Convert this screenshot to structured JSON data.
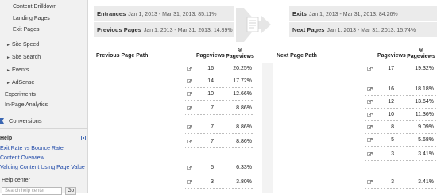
{
  "sidebar": {
    "items": [
      {
        "label": "Content Drilldown"
      },
      {
        "label": "Landing Pages"
      },
      {
        "label": "Exit Pages"
      },
      {
        "label": "Site Speed"
      },
      {
        "label": "Site Search"
      },
      {
        "label": "Events"
      },
      {
        "label": "AdSense"
      },
      {
        "label": "Experiments"
      },
      {
        "label": "In-Page Analytics"
      }
    ],
    "conversions_label": "Conversions",
    "help": {
      "heading": "Help",
      "links": [
        "Exit Rate vs Bounce Rate",
        "Content Overview",
        "Valuing Content Using Page Value"
      ],
      "help_center": "Help center",
      "search_placeholder": "Search help center",
      "go_label": "Go"
    }
  },
  "flow": {
    "entrances": {
      "label": "Entrances",
      "range": "Jan 1, 2013 - Mar 31, 2013: 85.11%"
    },
    "previous_pages": {
      "label": "Previous Pages",
      "range": "Jan 1, 2013 - Mar 31, 2013: 14.89%"
    },
    "exits": {
      "label": "Exits",
      "range": "Jan 1, 2013 - Mar 31, 2013: 84.26%"
    },
    "next_pages": {
      "label": "Next Pages",
      "range": "Jan 1, 2013 - Mar 31, 2013: 15.74%"
    }
  },
  "previous_table": {
    "headers": {
      "path": "Previous Page Path",
      "pageviews": "Pageviews",
      "pct": "% Pageviews"
    },
    "rows": [
      {
        "pageviews": "16",
        "pct": "20.25%"
      },
      {
        "pageviews": "14",
        "pct": "17.72%"
      },
      {
        "pageviews": "10",
        "pct": "12.66%"
      },
      {
        "pageviews": "7",
        "pct": "8.86%"
      },
      {
        "pageviews": "7",
        "pct": "8.86%"
      },
      {
        "pageviews": "7",
        "pct": "8.86%"
      },
      {
        "pageviews": "5",
        "pct": "6.33%"
      },
      {
        "pageviews": "3",
        "pct": "3.80%"
      }
    ]
  },
  "next_table": {
    "headers": {
      "path": "Next Page Path",
      "pageviews": "Pageviews",
      "pct": "% Pageviews"
    },
    "rows": [
      {
        "pageviews": "17",
        "pct": "19.32%"
      },
      {
        "pageviews": "16",
        "pct": "18.18%"
      },
      {
        "pageviews": "12",
        "pct": "13.64%"
      },
      {
        "pageviews": "10",
        "pct": "11.36%"
      },
      {
        "pageviews": "8",
        "pct": "9.09%"
      },
      {
        "pageviews": "5",
        "pct": "5.68%"
      },
      {
        "pageviews": "3",
        "pct": "3.41%"
      },
      {
        "pageviews": "3",
        "pct": "3.41%"
      }
    ]
  },
  "colors": {
    "link": "#1f49a8",
    "accent": "#3a66b2",
    "box_bg": "#ebebeb"
  }
}
